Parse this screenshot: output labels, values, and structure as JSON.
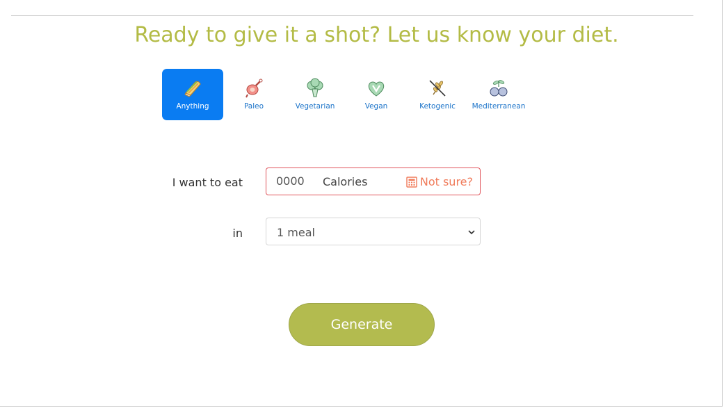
{
  "headline": "Ready to give it a shot? Let us know your diet.",
  "diets": [
    {
      "label": "Anything",
      "icon": "sandwich-icon",
      "selected": true
    },
    {
      "label": "Paleo",
      "icon": "drumstick-icon",
      "selected": false
    },
    {
      "label": "Vegetarian",
      "icon": "broccoli-icon",
      "selected": false
    },
    {
      "label": "Vegan",
      "icon": "vegan-heart-icon",
      "selected": false
    },
    {
      "label": "Ketogenic",
      "icon": "no-grain-icon",
      "selected": false
    },
    {
      "label": "Mediterranean",
      "icon": "olives-icon",
      "selected": false
    }
  ],
  "form": {
    "calories_label": "I want to eat",
    "calories_placeholder": "0000",
    "calories_unit": "Calories",
    "not_sure": "Not sure?",
    "meals_label": "in",
    "meals_value": "1 meal"
  },
  "generate_label": "Generate",
  "colors": {
    "accent": "#b3bb45",
    "selected": "#0a7cf2",
    "diet_label": "#1b73c9",
    "error_border": "#e0535a",
    "not_sure": "#f07b5a"
  }
}
